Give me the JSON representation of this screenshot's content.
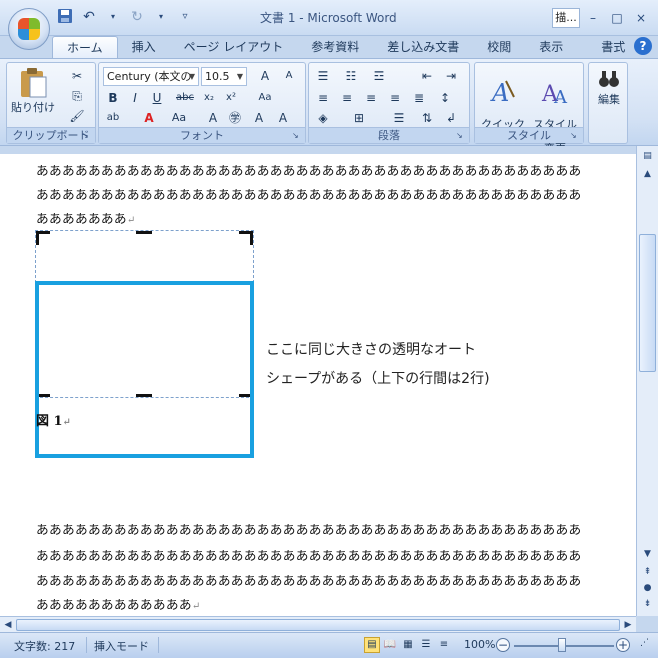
{
  "window": {
    "title": "文書 1 - Microsoft Word",
    "taskbar_snippet": "描...",
    "minimize": "–",
    "maximize": "□",
    "close": "×"
  },
  "qat": {
    "save_icon": "save-icon",
    "undo_icon": "undo-icon",
    "redo_icon": "redo-icon"
  },
  "tabs": [
    {
      "label": "ホーム",
      "active": true
    },
    {
      "label": "挿入"
    },
    {
      "label": "ページ レイアウト"
    },
    {
      "label": "参考資料"
    },
    {
      "label": "差し込み文書"
    },
    {
      "label": "校閲"
    },
    {
      "label": "表示"
    },
    {
      "label": "書式"
    }
  ],
  "help": "?",
  "ribbon": {
    "clipboard": {
      "label": "クリップボード",
      "paste": "貼り付け"
    },
    "font": {
      "label": "フォント",
      "font_name": "Century (本文の",
      "font_size": "10.5"
    },
    "paragraph": {
      "label": "段落"
    },
    "styles": {
      "label": "スタイル",
      "quick_style": "クイック\nスタイル",
      "change_style": "スタイルの\n変更"
    },
    "editing": {
      "label": "編集"
    }
  },
  "document": {
    "lines_top": [
      "ああああああああああああああああああああああああああああああああああああああああああ",
      "ああああああああああああああああああああああああああああああああああああああああああ",
      "あああああああ"
    ],
    "caption": "図 1",
    "note_line1": "ここに同じ大きさの透明なオート",
    "note_line2": "シェープがある（上下の行間は2行)",
    "lines_bottom": [
      "ああああああああああああああああああああああああああああああああああああああああああ",
      "ああああああああああああああああああああああああああああああああああああああああああ",
      "ああああああああああああああああああああああああああああああああああああああああああ",
      "ああああああああああああ"
    ],
    "para_mark": "↵"
  },
  "statusbar": {
    "word_count": "文字数: 217",
    "mode": "挿入モード",
    "zoom": "100%",
    "zoom_minus": "−",
    "zoom_plus": "+"
  }
}
